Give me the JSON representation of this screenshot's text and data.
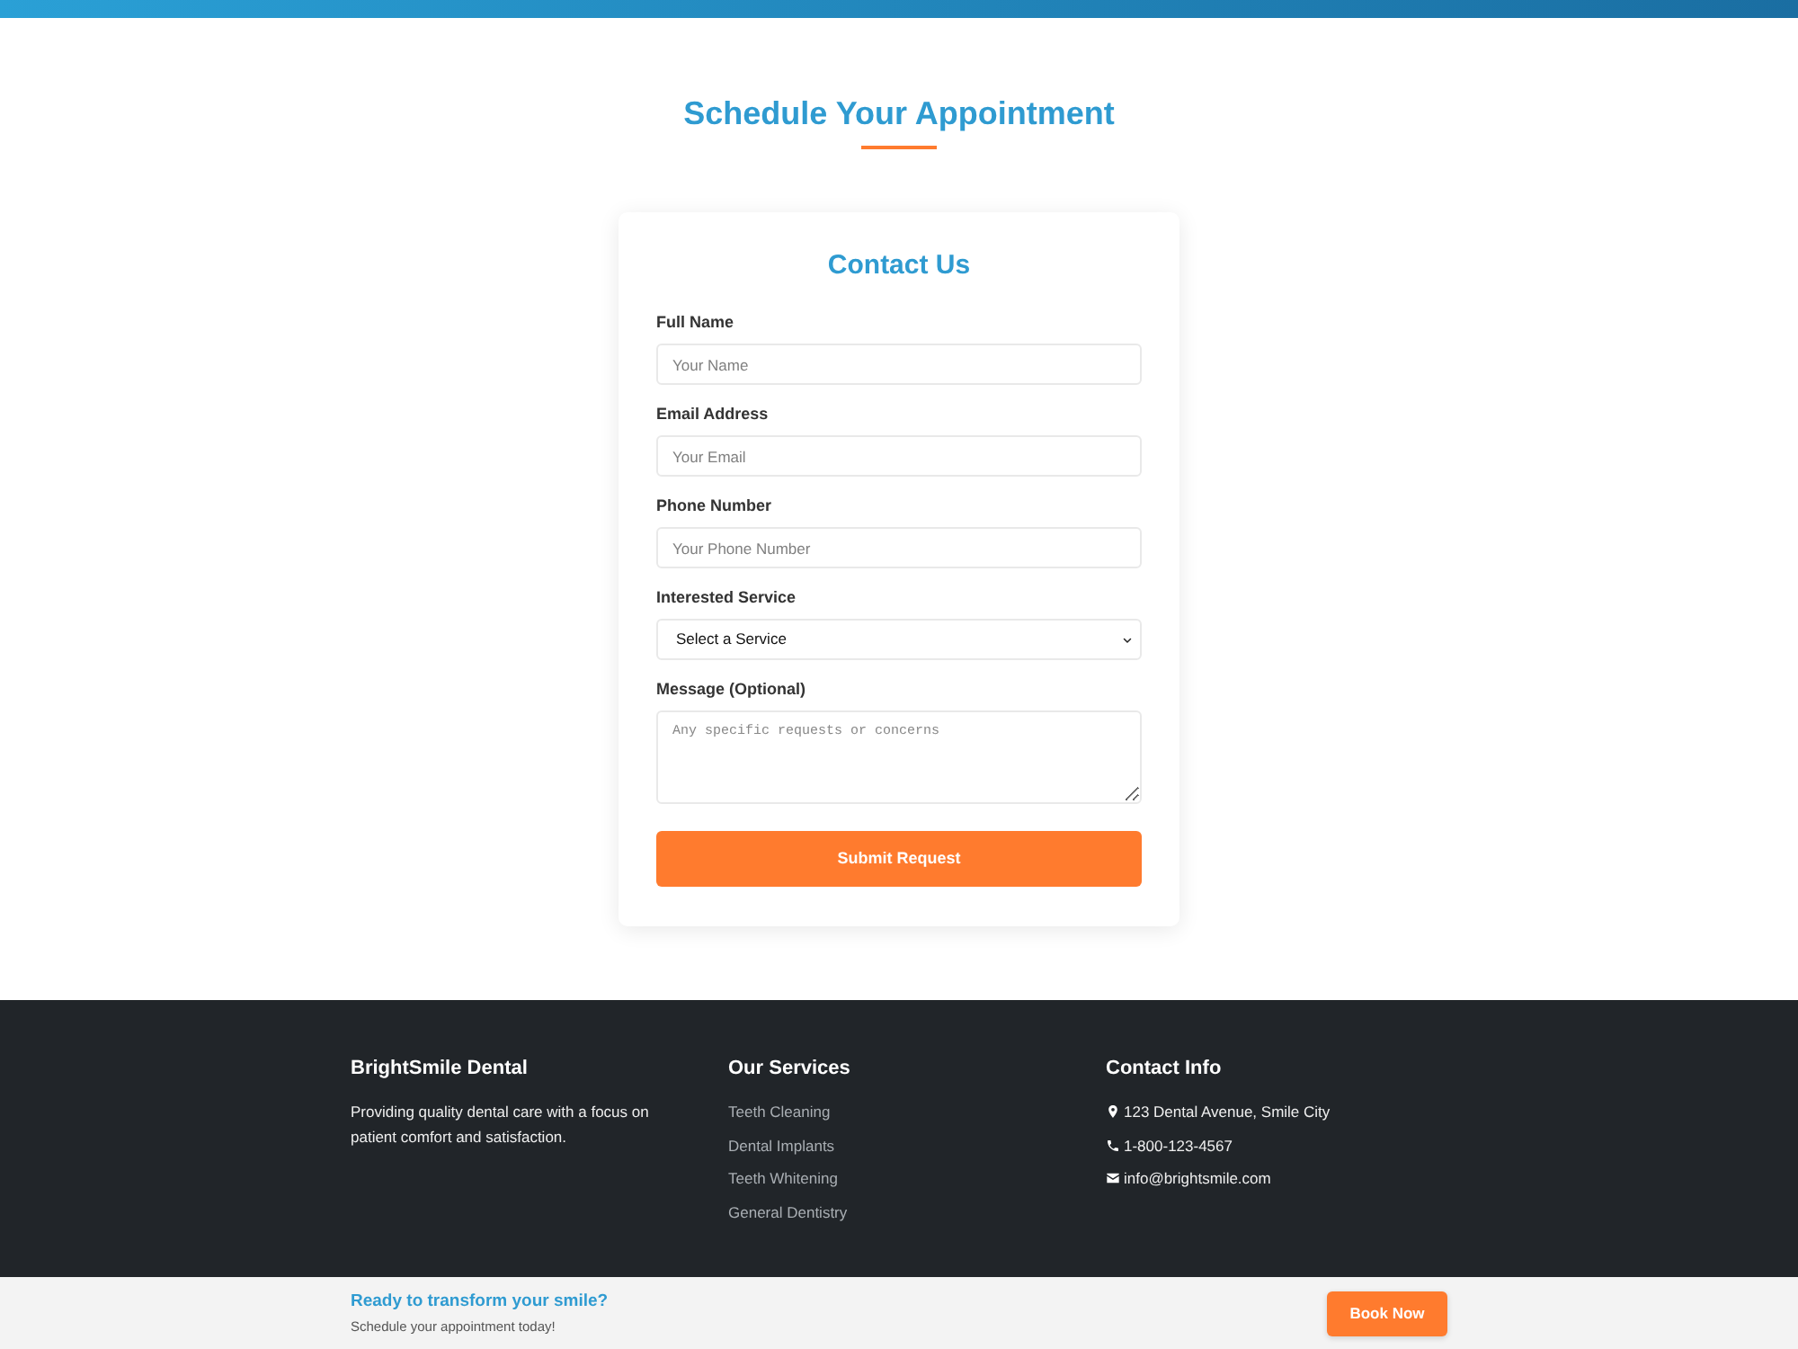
{
  "section": {
    "title": "Schedule Your Appointment"
  },
  "form": {
    "title": "Contact Us",
    "fields": [
      {
        "kind": "text",
        "label": "Full Name",
        "placeholder": "Your Name"
      },
      {
        "kind": "text",
        "label": "Email Address",
        "placeholder": "Your Email"
      },
      {
        "kind": "text",
        "label": "Phone Number",
        "placeholder": "Your Phone Number"
      },
      {
        "kind": "select",
        "label": "Interested Service",
        "value": "Select a Service"
      },
      {
        "kind": "textarea",
        "label": "Message (Optional)",
        "placeholder": "Any specific requests or concerns"
      }
    ],
    "submit_button": "Submit Request"
  },
  "footer": {
    "columns": [
      {
        "kind": "about",
        "title": "BrightSmile Dental",
        "text": "Providing quality dental care with a focus on patient comfort and satisfaction."
      },
      {
        "kind": "links",
        "title": "Our Services",
        "links": [
          "Teeth Cleaning",
          "Dental Implants",
          "Teeth Whitening",
          "General Dentistry"
        ]
      },
      {
        "kind": "contacts",
        "title": "Contact Info",
        "items": [
          {
            "kind": "address",
            "text": "123 Dental Avenue, Smile City"
          },
          {
            "kind": "phone",
            "text": "1-800-123-4567"
          },
          {
            "kind": "email",
            "text": "info@brightsmile.com"
          }
        ]
      }
    ]
  },
  "cta_bar": {
    "title": "Ready to transform your smile?",
    "subtitle": "Schedule your appointment today!",
    "button": "Book Now"
  }
}
